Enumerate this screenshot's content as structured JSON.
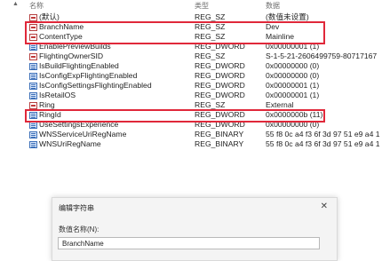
{
  "columns": {
    "name": "名称",
    "type": "类型",
    "data": "数据"
  },
  "rows": [
    {
      "name": "(默认)",
      "type": "REG_SZ",
      "data": "(数值未设置)",
      "icon": "string-value-icon"
    },
    {
      "name": "BranchName",
      "type": "REG_SZ",
      "data": "Dev",
      "icon": "string-value-icon"
    },
    {
      "name": "ContentType",
      "type": "REG_SZ",
      "data": "Mainline",
      "icon": "string-value-icon"
    },
    {
      "name": "EnablePreviewBuilds",
      "type": "REG_DWORD",
      "data": "0x00000001 (1)",
      "icon": "binary-value-icon"
    },
    {
      "name": "FlightingOwnerSID",
      "type": "REG_SZ",
      "data": "S-1-5-21-2606499759-80717167",
      "icon": "string-value-icon"
    },
    {
      "name": "IsBuildFlightingEnabled",
      "type": "REG_DWORD",
      "data": "0x00000000 (0)",
      "icon": "binary-value-icon"
    },
    {
      "name": "IsConfigExpFlightingEnabled",
      "type": "REG_DWORD",
      "data": "0x00000000 (0)",
      "icon": "binary-value-icon"
    },
    {
      "name": "IsConfigSettingsFlightingEnabled",
      "type": "REG_DWORD",
      "data": "0x00000001 (1)",
      "icon": "binary-value-icon"
    },
    {
      "name": "IsRetailOS",
      "type": "REG_DWORD",
      "data": "0x00000001 (1)",
      "icon": "binary-value-icon"
    },
    {
      "name": "Ring",
      "type": "REG_SZ",
      "data": "External",
      "icon": "string-value-icon"
    },
    {
      "name": "RingId",
      "type": "REG_DWORD",
      "data": "0x0000000b (11)",
      "icon": "binary-value-icon"
    },
    {
      "name": "UseSettingsExperience",
      "type": "REG_DWORD",
      "data": "0x00000000 (0)",
      "icon": "binary-value-icon"
    },
    {
      "name": "WNSServiceUriRegName",
      "type": "REG_BINARY",
      "data": "55 f8 0c a4 f3 6f 3d 97 51 e9 a4 1",
      "icon": "binary-value-icon"
    },
    {
      "name": "WNSUriRegName",
      "type": "REG_BINARY",
      "data": "55 f8 0c a4 f3 6f 3d 97 51 e9 a4 1",
      "icon": "binary-value-icon"
    }
  ],
  "dialog": {
    "title": "编辑字符串",
    "close": "✕",
    "name_label": "数值名称(N):",
    "name_value": "BranchName"
  },
  "colors": {
    "highlight": "#e0283a",
    "dialog_bg": "#f4f4f4"
  }
}
